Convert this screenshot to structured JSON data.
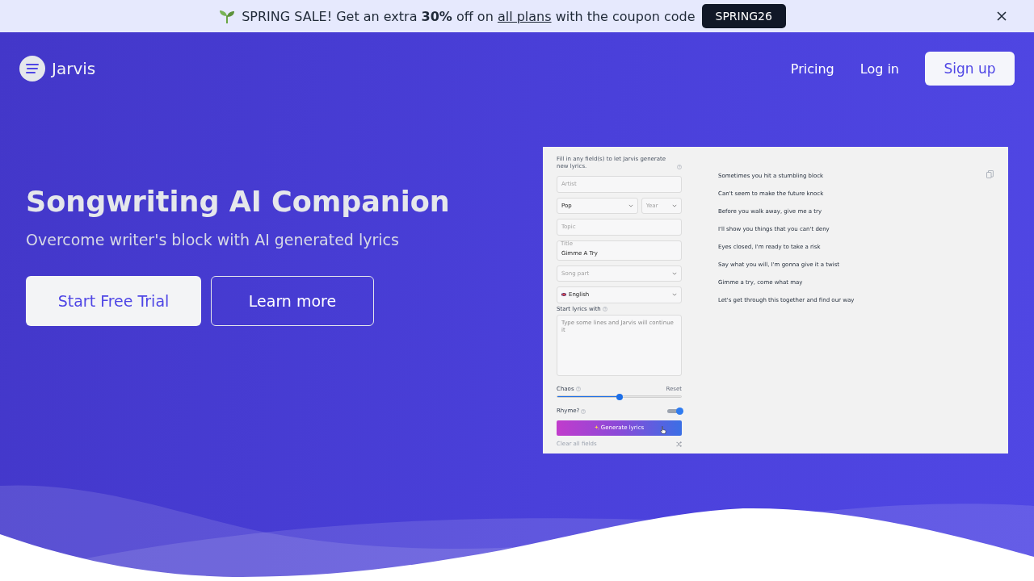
{
  "announcement": {
    "message": "SPRING SALE! Get an extra **30%** off on",
    "link": "all plans",
    "message_end": "with the coupon code",
    "coupon": "SPRING26"
  },
  "header": {
    "brand": "Jarvis",
    "nav": [
      {
        "label": "Pricing",
        "kind": "link"
      },
      {
        "label": "Log in",
        "kind": "link"
      },
      {
        "label": "Sign up",
        "kind": "button"
      }
    ]
  },
  "hero": {
    "title": "Songwriting AI Companion",
    "subtitle": "Overcome writer's block with AI generated lyrics",
    "buttons": [
      {
        "label": "Start Free Trial",
        "kind": "primary"
      },
      {
        "label": "Learn more",
        "kind": "outline"
      }
    ]
  },
  "app_preview": {
    "intro": "Fill in any field(s) to let Jarvis generate new lyrics.",
    "field_rows": [
      [
        {
          "kind": "input",
          "placeholder": "Artist"
        }
      ],
      [
        {
          "kind": "select",
          "value": "Pop"
        },
        {
          "kind": "select",
          "placeholder": "Year"
        }
      ],
      [
        {
          "kind": "input",
          "placeholder": "Topic"
        }
      ],
      [
        {
          "kind": "input",
          "label": "Title",
          "value": "Gimme A Try"
        }
      ],
      [
        {
          "kind": "select",
          "placeholder": "Song part"
        }
      ],
      [
        {
          "kind": "language",
          "value": "English"
        }
      ]
    ],
    "prompt": {
      "label": "Start lyrics with",
      "placeholder": "Type some lines and Jarvis will continue it"
    },
    "chaos": {
      "label": "Chaos",
      "reset": "Reset",
      "level": 0.5
    },
    "rhyme": {
      "label": "Rhyme?",
      "on": true
    },
    "generate_button": "Generate lyrics",
    "clear": "Clear all fields",
    "lyrics": [
      "Sometimes you hit a stumbling block",
      "Can't seem to make the future knock",
      "Before you walk away, give me a try",
      "I'll show you things that you can't deny",
      "Eyes closed, I'm ready to take a risk",
      "Say what you will, I'm gonna give it a twist",
      "Gimme a try, come what may",
      "Let's get through this together and find our way"
    ]
  }
}
